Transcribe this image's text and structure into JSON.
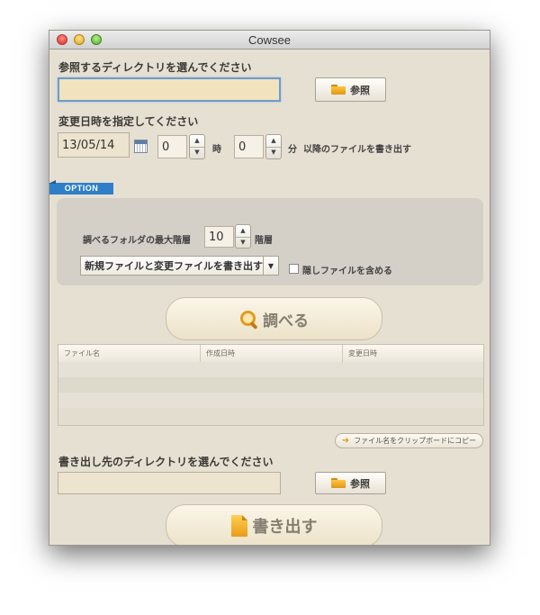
{
  "window": {
    "title": "Cowsee"
  },
  "source": {
    "label": "参照するディレクトリを選んでください",
    "path_value": "",
    "browse_label": "参照"
  },
  "date": {
    "label": "変更日時を指定してください",
    "date_value": "13/05/14",
    "hour_value": "0",
    "hour_unit": "時",
    "minute_value": "0",
    "minute_unit": "分",
    "suffix": "以降のファイルを書き出す"
  },
  "option": {
    "tag": "OPTION",
    "depth_label": "調べるフォルダの最大階層",
    "depth_value": "10",
    "depth_unit": "階層",
    "mode_selected": "新規ファイルと変更ファイルを書き出す",
    "hidden_label": "隠しファイルを含める",
    "hidden_checked": false
  },
  "search_button": "調べる",
  "table": {
    "columns": [
      "ファイル名",
      "作成日時",
      "変更日時"
    ],
    "rows": []
  },
  "clipboard_button": "ファイル名をクリップボードにコピー",
  "export": {
    "label": "書き出し先のディレクトリを選んでください",
    "path_value": "",
    "browse_label": "参照",
    "export_button": "書き出す"
  }
}
